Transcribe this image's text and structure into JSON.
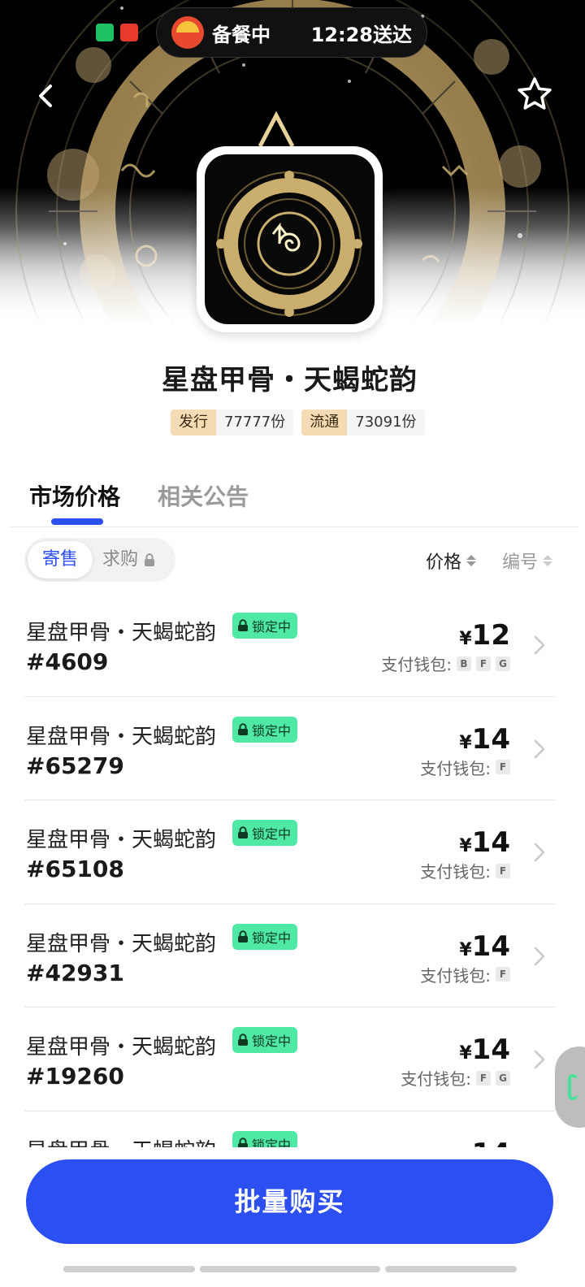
{
  "status_bar": {
    "delivery_status": "备餐中",
    "delivery_time": "12:28送达"
  },
  "product": {
    "title": "星盘甲骨・天蝎蛇韵",
    "tags": [
      {
        "key": "发行",
        "value": "77777份"
      },
      {
        "key": "流通",
        "value": "73091份"
      }
    ]
  },
  "tabs": [
    {
      "label": "市场价格",
      "active": true
    },
    {
      "label": "相关公告",
      "active": false
    }
  ],
  "segment": {
    "active": "寄售",
    "inactive": "求购"
  },
  "sort": {
    "price_label": "价格",
    "number_label": "编号"
  },
  "listing_common": {
    "name": "星盘甲骨・天蝎蛇韵",
    "badge": "锁定中",
    "wallet_label": "支付钱包:",
    "currency": "¥"
  },
  "listings": [
    {
      "serial": "#4609",
      "price": "12",
      "wallets": [
        "B",
        "F",
        "G"
      ]
    },
    {
      "serial": "#65279",
      "price": "14",
      "wallets": [
        "F"
      ]
    },
    {
      "serial": "#65108",
      "price": "14",
      "wallets": [
        "F"
      ]
    },
    {
      "serial": "#42931",
      "price": "14",
      "wallets": [
        "F"
      ]
    },
    {
      "serial": "#19260",
      "price": "14",
      "wallets": [
        "F",
        "G"
      ]
    },
    {
      "serial": "",
      "price": "14",
      "wallets": []
    }
  ],
  "buy_button": "批量购买",
  "colors": {
    "accent": "#2b4ff0",
    "badge_green": "#4fe8a4",
    "tag_key_bg": "#f3dcb4"
  }
}
